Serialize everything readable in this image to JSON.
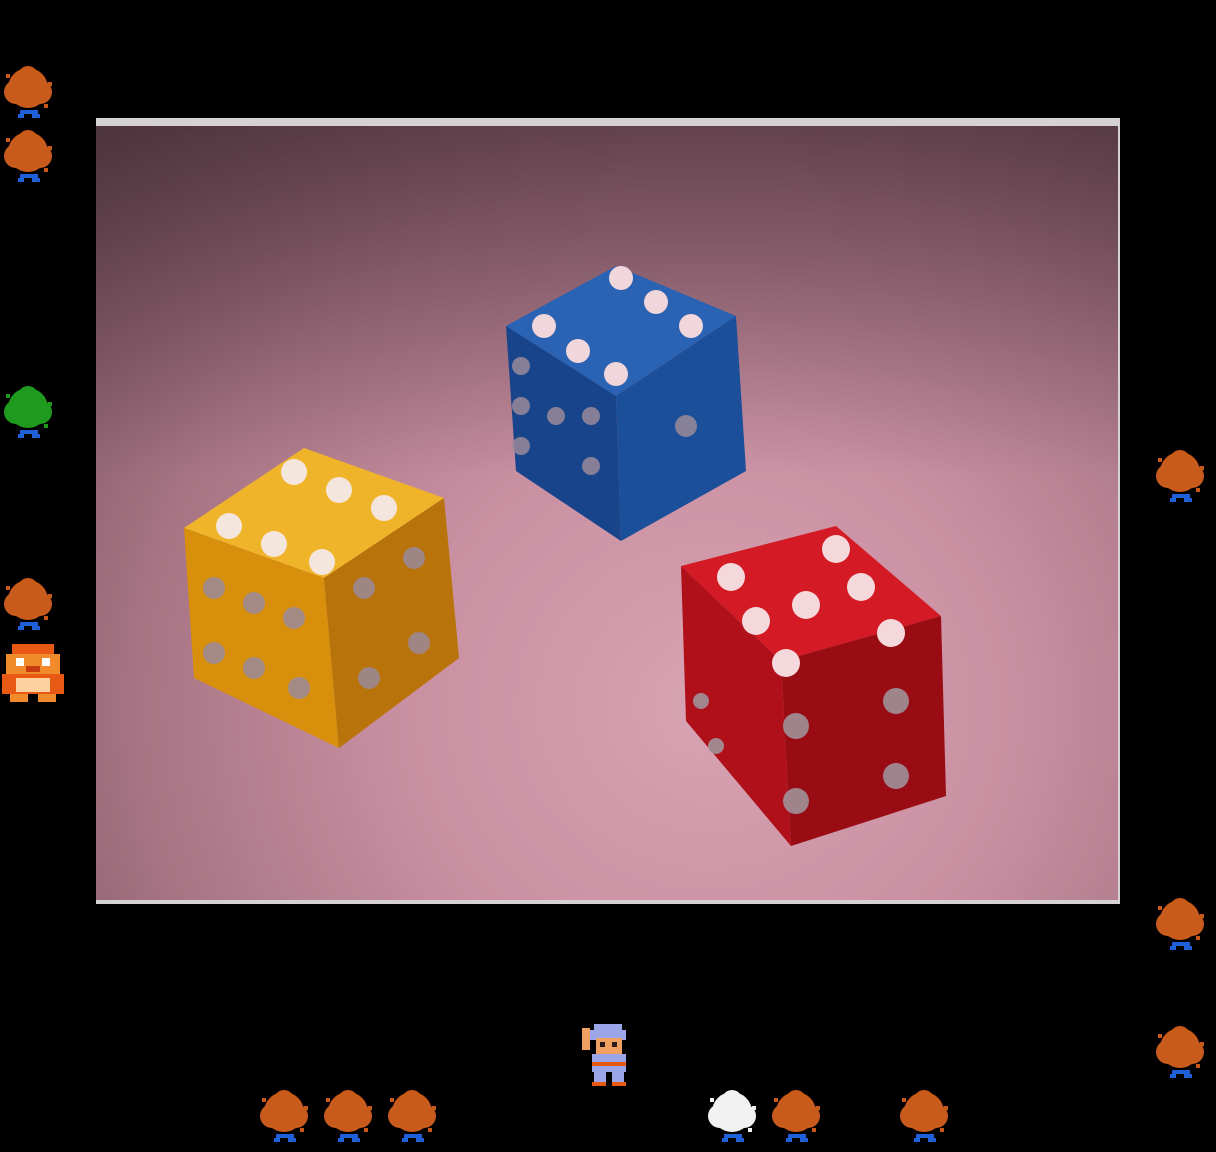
{
  "scene": {
    "background_color": "#000000",
    "photo_frame_color": "#d6d2d4",
    "dice": [
      {
        "name": "orange-die",
        "color": "#e3a010",
        "shadow": "#8a5a08",
        "pip": "#f4e6dc"
      },
      {
        "name": "blue-die",
        "color": "#1c4f9a",
        "shadow": "#0f2c5e",
        "pip": "#f1d6dc"
      },
      {
        "name": "red-die",
        "color": "#c6141c",
        "shadow": "#6e070d",
        "pip": "#f4d8dc"
      }
    ]
  },
  "sprites": {
    "bush_brown_color": "#c85a1c",
    "bush_green_color": "#1f9a1f",
    "bush_white_color": "#f2f2f2",
    "root_color": "#1f5fd8",
    "player_icon": "hero-icon",
    "enemy_icon": "red-warrior-icon",
    "bush_icon": "bush-icon"
  }
}
